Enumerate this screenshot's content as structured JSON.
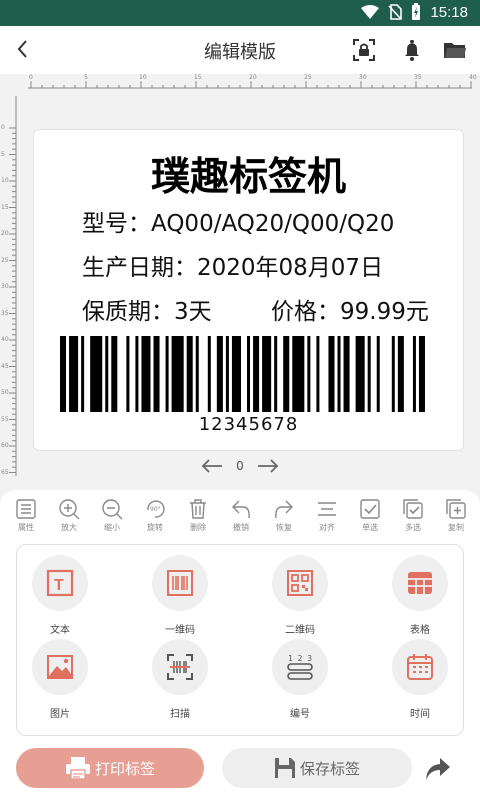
{
  "status_bar": {
    "time": "15:18",
    "battery_icon": "battery-charging-icon",
    "wifi_icon": "wifi-icon",
    "sim_icon": "no-sim-icon"
  },
  "app_bar": {
    "title": "编辑模版",
    "back_icon": "back-arrow-icon",
    "actions": [
      {
        "name": "scan-lock-icon"
      },
      {
        "name": "bell-icon"
      },
      {
        "name": "folder-icon"
      }
    ]
  },
  "ruler": {
    "top_labels": [
      "0",
      "5",
      "10",
      "15",
      "20",
      "25",
      "30",
      "35",
      "40"
    ],
    "side_labels": [
      "0",
      "5",
      "10",
      "15",
      "20",
      "25",
      "30",
      "35",
      "40",
      "45",
      "50",
      "55",
      "60",
      "65"
    ]
  },
  "label": {
    "title": "璞趣标签机",
    "model": "型号：AQ00/AQ20/Q00/Q20",
    "production_date": "生产日期：2020年08月07日",
    "shelf_life": "保质期：3天",
    "price": "价格：99.99元",
    "barcode_number": "12345678"
  },
  "pager": {
    "page": "0",
    "prev_icon": "arrow-left-icon",
    "next_icon": "arrow-right-icon"
  },
  "toolbar": [
    {
      "label": "属性",
      "icon": "properties-icon"
    },
    {
      "label": "放大",
      "icon": "zoom-in-icon"
    },
    {
      "label": "缩小",
      "icon": "zoom-out-icon"
    },
    {
      "label": "旋转",
      "icon": "rotate-icon"
    },
    {
      "label": "删除",
      "icon": "delete-icon"
    },
    {
      "label": "撤销",
      "icon": "undo-icon"
    },
    {
      "label": "恢复",
      "icon": "redo-icon"
    },
    {
      "label": "对齐",
      "icon": "align-icon"
    },
    {
      "label": "单选",
      "icon": "single-select-icon"
    },
    {
      "label": "多选",
      "icon": "multi-select-icon"
    },
    {
      "label": "复制",
      "icon": "copy-icon"
    }
  ],
  "elements": [
    {
      "label": "文本",
      "icon": "text-icon"
    },
    {
      "label": "一维码",
      "icon": "barcode-icon"
    },
    {
      "label": "二维码",
      "icon": "qrcode-icon"
    },
    {
      "label": "表格",
      "icon": "table-icon"
    },
    {
      "label": "图片",
      "icon": "image-icon"
    },
    {
      "label": "扫描",
      "icon": "scan-icon"
    },
    {
      "label": "编号",
      "icon": "numbering-icon"
    },
    {
      "label": "时间",
      "icon": "calendar-icon"
    }
  ],
  "pagination": {
    "count": 3,
    "active": 1
  },
  "actions": {
    "print": "打印标签",
    "save": "保存标签",
    "share_icon": "share-icon"
  },
  "colors": {
    "status_bar": "#1e5e4a",
    "accent": "#e79e93",
    "icon_accent": "#e07060"
  }
}
